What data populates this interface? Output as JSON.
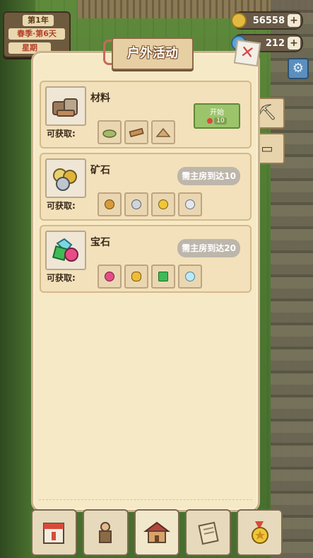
{
  "date": {
    "year": "第1年",
    "season_day": "春季·第6天",
    "weekday": "星期"
  },
  "currency": {
    "coins": "56558",
    "gems": "212",
    "plus": "+"
  },
  "panel": {
    "title": "户外活动",
    "close_glyph": "✕",
    "available_label": "可获取:"
  },
  "activities": [
    {
      "name": "材料",
      "start_label": "开始",
      "cost": "10"
    },
    {
      "name": "矿石",
      "requirement": "需主房到达10"
    },
    {
      "name": "宝石",
      "requirement": "需主房到达20"
    }
  ],
  "colors": {
    "gold": "#e4b93f",
    "gem_blue": "#5aa3d6",
    "start_green": "#9cc46b"
  },
  "icons": {
    "settings": "gear-icon",
    "pickaxe": "pickaxe-icon",
    "gun": "gun-icon",
    "calendar": "calendar-icon",
    "worker": "worker-icon",
    "house": "house-icon",
    "scroll": "scroll-icon",
    "medal": "medal-icon"
  }
}
